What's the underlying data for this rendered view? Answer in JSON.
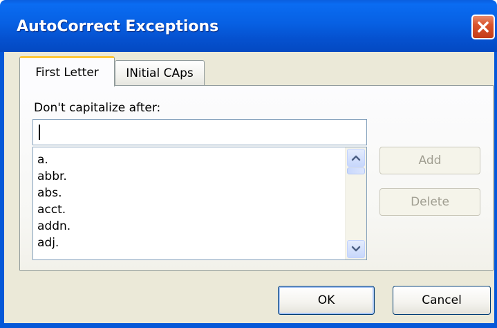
{
  "window": {
    "title": "AutoCorrect Exceptions"
  },
  "tabs": [
    {
      "label": "First Letter",
      "selected": true
    },
    {
      "label": "INitial CAps",
      "selected": false
    }
  ],
  "first_letter": {
    "prompt": "Don't capitalize after:",
    "entry_value": "",
    "list_items": [
      "a.",
      "abbr.",
      "abs.",
      "acct.",
      "addn.",
      "adj."
    ],
    "add_label": "Add",
    "delete_label": "Delete"
  },
  "buttons": {
    "ok": "OK",
    "cancel": "Cancel"
  },
  "colors": {
    "titlebar": "#0558d8",
    "client": "#ebe9d8",
    "tab_highlight": "#ffc83c",
    "close": "#d9542d",
    "disabled_text": "#a19f92"
  },
  "icons": {
    "close": "close-icon",
    "scroll_up": "chevron-up-icon",
    "scroll_down": "chevron-down-icon"
  }
}
